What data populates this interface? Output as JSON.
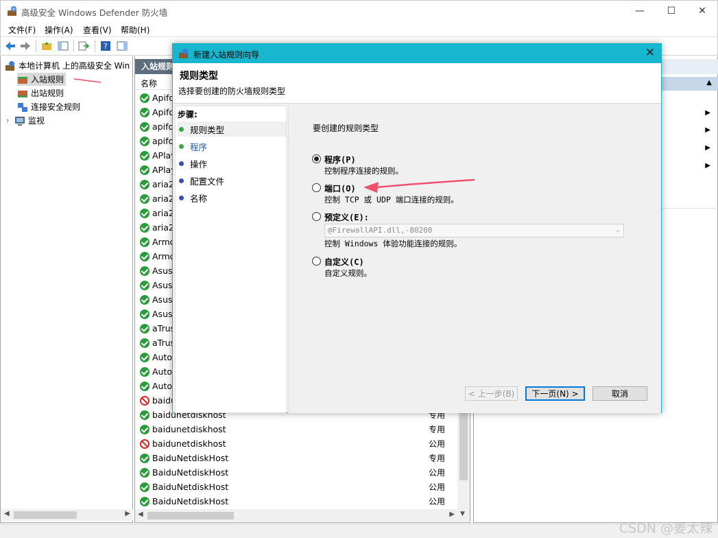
{
  "window": {
    "title": "高级安全 Windows Defender 防火墙",
    "minimize": "—",
    "maximize": "☐",
    "close": "✕"
  },
  "menu": [
    "文件(F)",
    "操作(A)",
    "查看(V)",
    "帮助(H)"
  ],
  "tree": {
    "root": "本地计算机 上的高级安全 Win",
    "items": [
      "入站规则",
      "出站规则",
      "连接安全规则",
      "监视"
    ]
  },
  "list": {
    "header": "入站规则",
    "col_name": "名称",
    "rows": [
      {
        "name": "Apifo",
        "status": "ok",
        "profile": ""
      },
      {
        "name": "Apifo",
        "status": "ok",
        "profile": ""
      },
      {
        "name": "apifo",
        "status": "ok",
        "profile": ""
      },
      {
        "name": "apifo",
        "status": "ok",
        "profile": ""
      },
      {
        "name": "APlay",
        "status": "ok",
        "profile": ""
      },
      {
        "name": "APlay",
        "status": "ok",
        "profile": ""
      },
      {
        "name": "aria2",
        "status": "ok",
        "profile": ""
      },
      {
        "name": "aria2",
        "status": "ok",
        "profile": ""
      },
      {
        "name": "aria2",
        "status": "ok",
        "profile": ""
      },
      {
        "name": "aria2",
        "status": "ok",
        "profile": ""
      },
      {
        "name": "Armo",
        "status": "ok",
        "profile": ""
      },
      {
        "name": "Armo",
        "status": "ok",
        "profile": ""
      },
      {
        "name": "AsusL",
        "status": "ok",
        "profile": ""
      },
      {
        "name": "AsusL",
        "status": "ok",
        "profile": ""
      },
      {
        "name": "AsusS",
        "status": "ok",
        "profile": ""
      },
      {
        "name": "AsusS",
        "status": "ok",
        "profile": ""
      },
      {
        "name": "aTrus",
        "status": "ok",
        "profile": ""
      },
      {
        "name": "aTrus",
        "status": "ok",
        "profile": ""
      },
      {
        "name": "AutoC",
        "status": "ok",
        "profile": ""
      },
      {
        "name": "AutoC",
        "status": "ok",
        "profile": ""
      },
      {
        "name": "AutoC",
        "status": "ok",
        "profile": ""
      },
      {
        "name": "baidu",
        "status": "no",
        "profile": ""
      },
      {
        "name": "baidunetdiskhost",
        "status": "ok",
        "profile": "专用"
      },
      {
        "name": "baidunetdiskhost",
        "status": "ok",
        "profile": "专用"
      },
      {
        "name": "baidunetdiskhost",
        "status": "no",
        "profile": "公用"
      },
      {
        "name": "BaiduNetdiskHost",
        "status": "ok",
        "profile": "专用"
      },
      {
        "name": "BaiduNetdiskHost",
        "status": "ok",
        "profile": "公用"
      },
      {
        "name": "BaiduNetdiskHost",
        "status": "ok",
        "profile": "公用"
      },
      {
        "name": "BaiduNetdiskHost",
        "status": "ok",
        "profile": "公用"
      }
    ]
  },
  "dialog": {
    "title": "新建入站规则向导",
    "close": "✕",
    "heading": "规则类型",
    "subheading": "选择要创建的防火墙规则类型",
    "steps_title": "步骤:",
    "steps": [
      {
        "label": "规则类型",
        "color": "#3aa64a"
      },
      {
        "label": "程序",
        "color": "#3aa64a"
      },
      {
        "label": "操作",
        "color": "#3b4fb0"
      },
      {
        "label": "配置文件",
        "color": "#3b4fb0"
      },
      {
        "label": "名称",
        "color": "#3b4fb0"
      }
    ],
    "question": "要创建的规则类型",
    "options": [
      {
        "label": "程序(P)",
        "desc": "控制程序连接的规则。",
        "selected": true
      },
      {
        "label": "端口(O)",
        "desc": "控制 TCP 或 UDP 端口连接的规则。",
        "selected": false
      },
      {
        "label": "预定义(E):",
        "desc": "控制 Windows 体验功能连接的规则。",
        "selected": false
      },
      {
        "label": "自定义(C)",
        "desc": "自定义规则。",
        "selected": false
      }
    ],
    "predefined_value": "@FirewallAPI.dll,-80200",
    "buttons": {
      "back": "< 上一步(B)",
      "next": "下一页(N) >",
      "cancel": "取消"
    }
  },
  "watermark": "CSDN @姜太辣",
  "colors": {
    "accent": "#19b7cf",
    "annotation_arrow": "#f0506e",
    "status_ok": "#2c9b3c",
    "status_blocked": "#d52a2a"
  }
}
